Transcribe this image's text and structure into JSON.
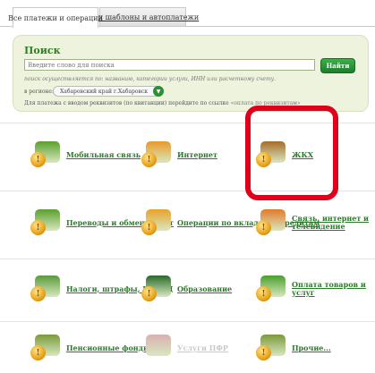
{
  "tabs": {
    "active_label": "Все платежи и операции",
    "second_label": "Мои шаблоны и автоплатежи"
  },
  "search": {
    "title": "Поиск",
    "placeholder": "Введите слово для поиска",
    "button_label": "Найти",
    "hint": "поиск осуществляется по: названию, категории услуги, ИНН или расчетному счету.",
    "region_label": "в регионе:",
    "region_value": "Хабаровский край г.Хабаровск",
    "requisites_text": "Для платежа с вводом реквизитов (по квитанции) перейдите по ссылке",
    "requisites_link": "«оплата по реквизитам»"
  },
  "categories": [
    {
      "label": "Мобильная связь",
      "icon": "mobile-phone-icon",
      "color": "#5aa02c"
    },
    {
      "label": "Интернет",
      "icon": "laptop-icon",
      "color": "#e89a2a"
    },
    {
      "label": "ЖКХ",
      "icon": "house-icon",
      "color": "#a86b2a"
    },
    {
      "label": "Переводы и обмен валют",
      "icon": "money-transfer-icon",
      "color": "#5aa02c"
    },
    {
      "label": "Операции по вкладам и кредитам",
      "icon": "deposit-icon",
      "color": "#e8a22a"
    },
    {
      "label": "Связь, интернет и телевидение",
      "icon": "communication-icon",
      "color": "#e27a2a"
    },
    {
      "label": "Налоги, штрафы, ГИБДД",
      "icon": "taxes-icon",
      "color": "#5a9a3a"
    },
    {
      "label": "Образование",
      "icon": "graduation-cap-icon",
      "color": "#2a6a2a"
    },
    {
      "label": "Оплата товаров и услуг",
      "icon": "shopping-basket-icon",
      "color": "#4aa02c"
    },
    {
      "label": "Пенсионные фонды",
      "icon": "pension-building-icon",
      "color": "#7a9a3a"
    },
    {
      "label": "Услуги ПФР",
      "icon": "pfr-logo-icon",
      "color": "#d9b0b0"
    },
    {
      "label": "Прочие...",
      "icon": "other-icon",
      "color": "#7a9a3a"
    }
  ],
  "colors": {
    "accent_green": "#2f7d1f",
    "highlight_red": "#e0001b"
  }
}
